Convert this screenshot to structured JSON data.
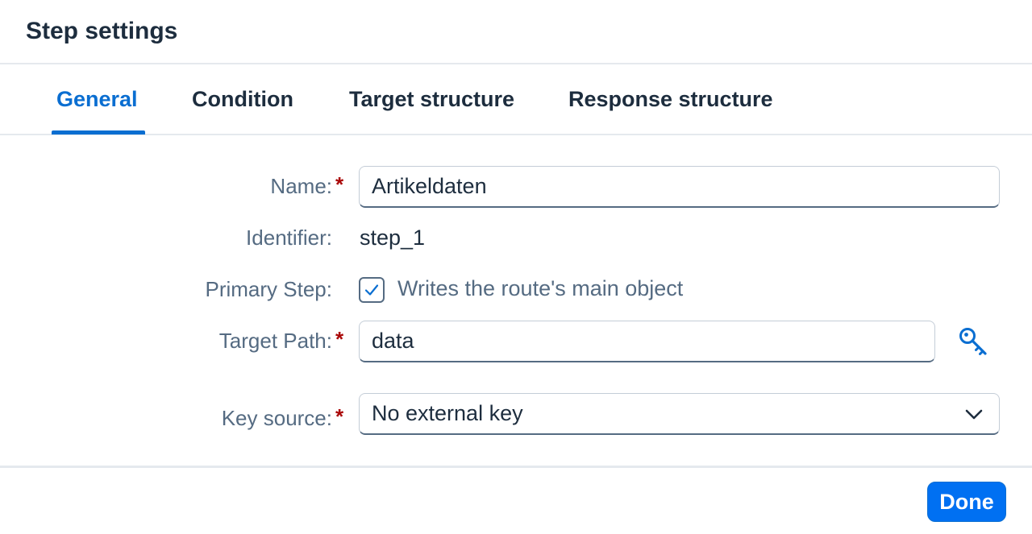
{
  "dialog": {
    "title": "Step settings"
  },
  "tabs": [
    {
      "label": "General",
      "active": true
    },
    {
      "label": "Condition",
      "active": false
    },
    {
      "label": "Target structure",
      "active": false
    },
    {
      "label": "Response structure",
      "active": false
    }
  ],
  "form": {
    "name": {
      "label": "Name:",
      "required_mark": "*",
      "value": "Artikeldaten"
    },
    "identifier": {
      "label": "Identifier:",
      "value": "step_1"
    },
    "primary_step": {
      "label": "Primary Step:",
      "checked": true,
      "checkbox_label": "Writes the route's main object"
    },
    "target_path": {
      "label": "Target Path:",
      "required_mark": "*",
      "value": "data",
      "icon": "key-icon"
    },
    "key_source": {
      "label": "Key source:",
      "required_mark": "*",
      "value": "No external key",
      "icon": "chevron-down-icon"
    }
  },
  "footer": {
    "done_label": "Done"
  },
  "colors": {
    "accent": "#0a6ed1",
    "button": "#0070f2",
    "required": "#aa0808",
    "label": "#556b82",
    "text": "#1d2d3e"
  }
}
